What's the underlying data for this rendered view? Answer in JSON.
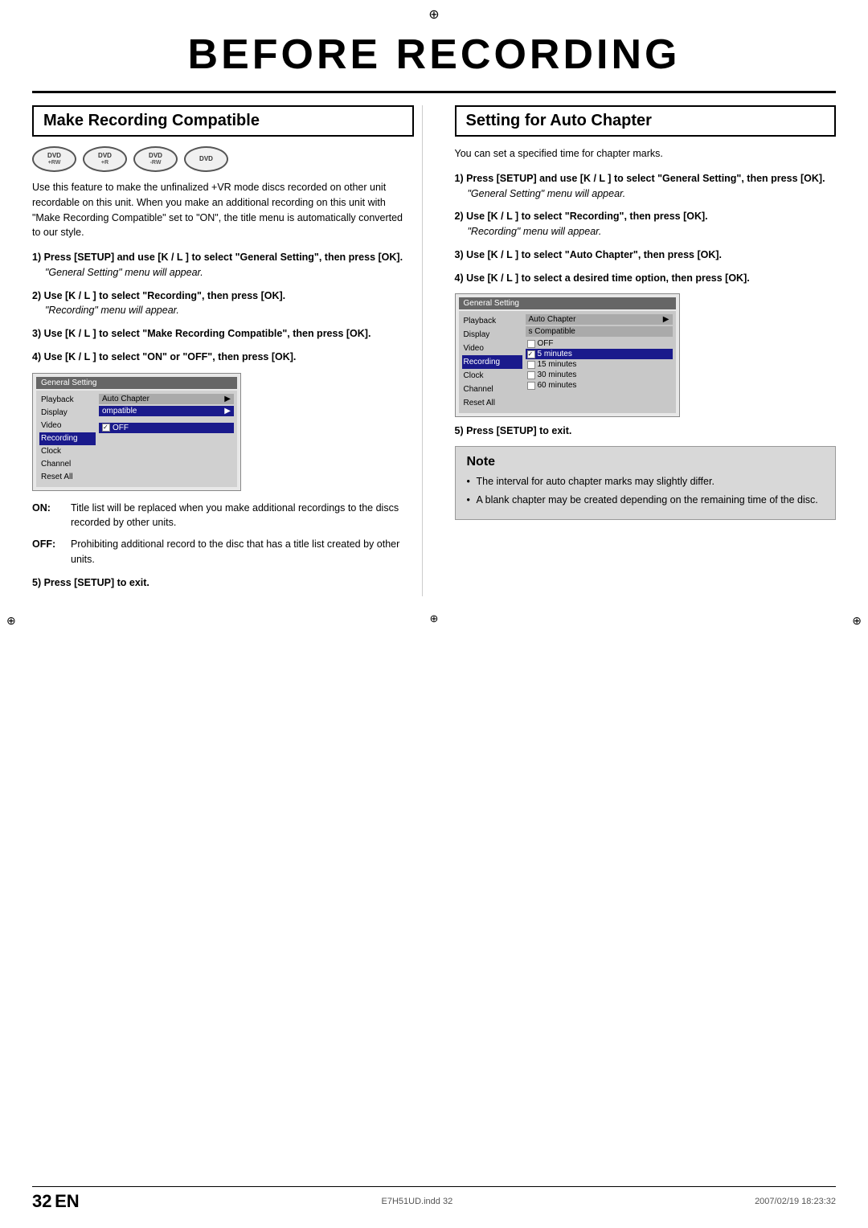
{
  "page": {
    "title": "BEFORE RECORDING",
    "reg_mark": "⊕",
    "page_number": "32",
    "page_label": "EN",
    "footer_left": "E7H51UD.indd  32",
    "footer_right": "2007/02/19  18:23:32"
  },
  "left_section": {
    "header": "Make Recording Compatible",
    "dvd_logos": [
      {
        "text": "DVD",
        "sub": "+RW"
      },
      {
        "text": "DVD",
        "sub": "+R"
      },
      {
        "text": "DVD",
        "sub": "-RW"
      },
      {
        "text": "DVD",
        "sub": ""
      }
    ],
    "intro_text": "Use this feature to make the unfinalized +VR mode discs recorded on other unit recordable on this unit. When you make an additional recording on this unit with \"Make Recording Compatible\" set to \"ON\", the title menu is automatically converted to our style.",
    "steps": [
      {
        "number": "1",
        "bold": "Press [SETUP] and use [K / L ] to select \"General Setting\", then press [OK].",
        "sub": "\"General Setting\" menu will appear."
      },
      {
        "number": "2",
        "bold": "Use [K / L ] to select \"Recording\", then press [OK].",
        "sub": "\"Recording\" menu will appear."
      },
      {
        "number": "3",
        "bold": "Use [K / L ] to select \"Make Recording Compatible\", then press [OK].",
        "sub": ""
      },
      {
        "number": "4",
        "bold": "Use [K / L ] to select \"ON\" or \"OFF\", then press [OK].",
        "sub": ""
      }
    ],
    "menu_title": "General Setting",
    "menu_items_left": [
      "Playback",
      "Display",
      "Video",
      "Recording",
      "Clock",
      "Channel",
      "Reset All"
    ],
    "menu_items_right": [
      "Auto Chapter",
      "ompatible"
    ],
    "menu_off_label": "OFF",
    "on_label": "ON:",
    "on_desc": "Title list will be replaced when you make additional recordings to the discs recorded by other units.",
    "off_label": "OFF:",
    "off_desc": "Prohibiting additional record to the disc that has a title list created by other units.",
    "press_setup": "5) Press [SETUP] to exit."
  },
  "right_section": {
    "header": "Setting for Auto Chapter",
    "intro_text": "You can set a specified time for chapter marks.",
    "steps": [
      {
        "number": "1",
        "bold": "Press [SETUP] and use [K / L ] to select \"General Setting\", then press [OK].",
        "sub": "\"General Setting\" menu will appear."
      },
      {
        "number": "2",
        "bold": "Use [K / L ] to select \"Recording\", then press [OK].",
        "sub": "\"Recording\" menu will appear."
      },
      {
        "number": "3",
        "bold": "Use [K / L ] to select \"Auto Chapter\", then press [OK].",
        "sub": ""
      },
      {
        "number": "4",
        "bold": "Use [K / L ] to select a desired time option, then press [OK].",
        "sub": ""
      }
    ],
    "menu_title": "General Setting",
    "menu_items_left": [
      "Playback",
      "Display",
      "Video",
      "Recording",
      "Clock",
      "Channel",
      "Reset All"
    ],
    "menu_right_label": "Auto Chapter",
    "menu_compatible_partial": "s Compatible",
    "options": [
      "OFF",
      "5 minutes",
      "15 minutes",
      "30 minutes",
      "60 minutes"
    ],
    "selected_option": "5 minutes",
    "press_setup": "5) Press [SETUP] to exit.",
    "note_title": "Note",
    "note_items": [
      "The interval for auto chapter marks may slightly differ.",
      "A blank chapter may be created depending on the remaining time of the disc."
    ]
  }
}
